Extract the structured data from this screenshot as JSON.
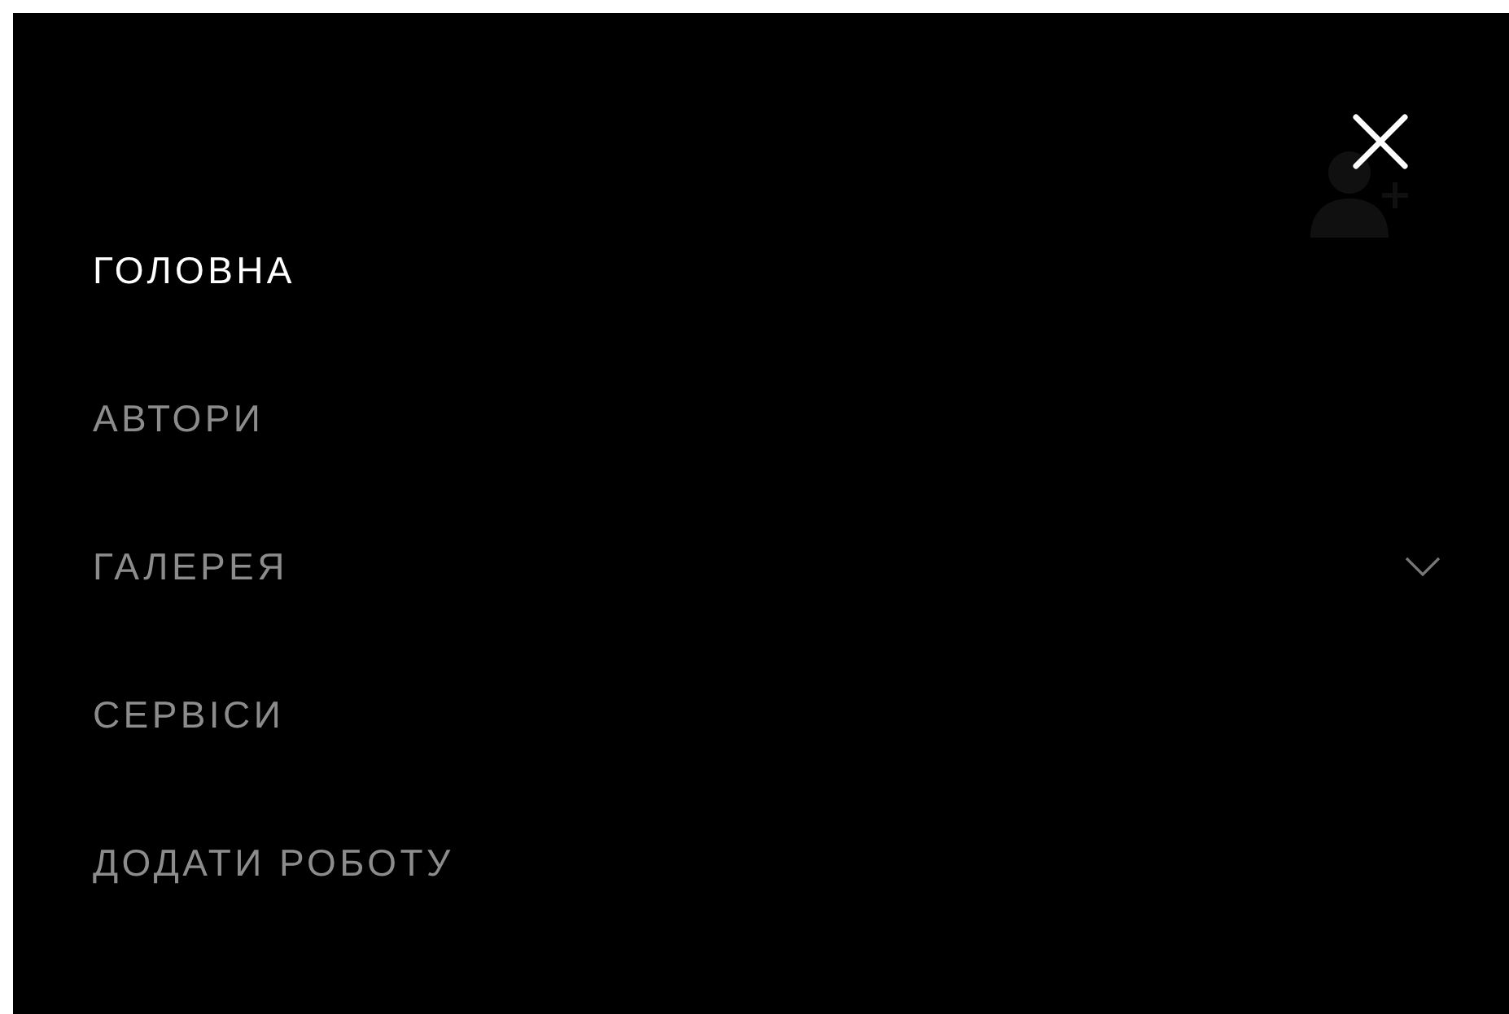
{
  "menu": {
    "items": [
      {
        "label": "ГОЛОВНА",
        "selected": true,
        "kind": "link"
      },
      {
        "label": "АВТОРИ",
        "selected": false,
        "kind": "link"
      },
      {
        "label": "ГАЛЕРЕЯ",
        "selected": false,
        "kind": "dropdown"
      },
      {
        "label": "СЕРВІСИ",
        "selected": false,
        "kind": "link"
      },
      {
        "label": "ДОДАТИ РОБОТУ",
        "selected": false,
        "kind": "link"
      }
    ]
  }
}
